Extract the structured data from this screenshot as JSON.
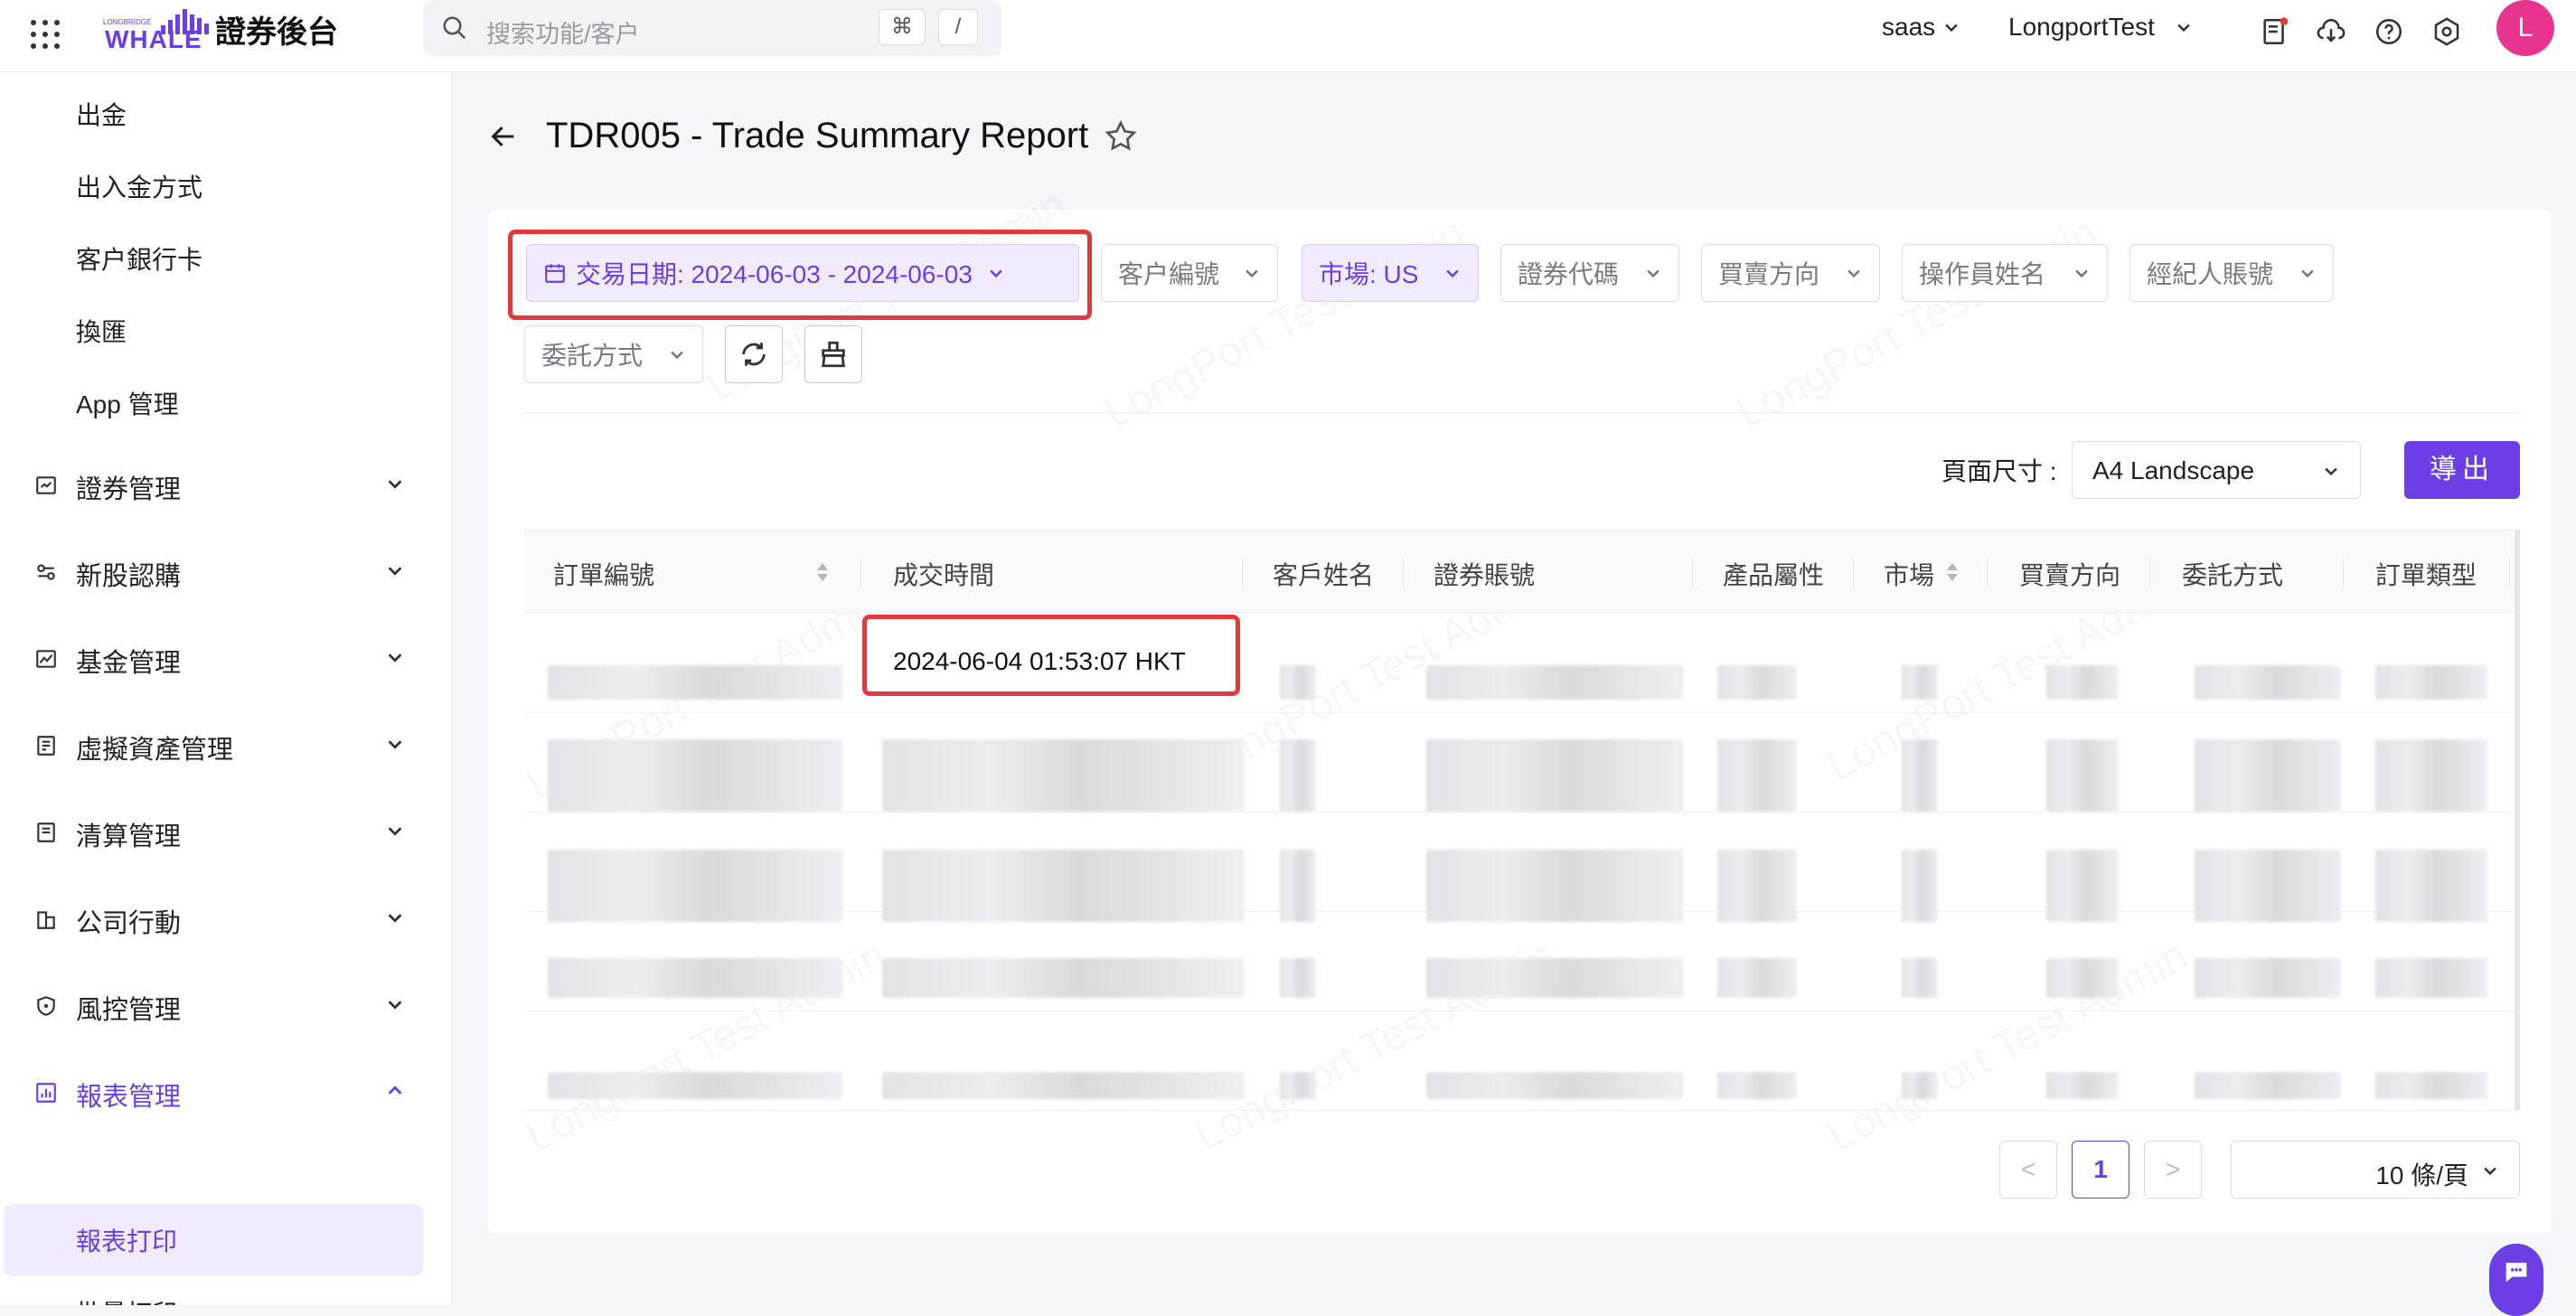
{
  "header": {
    "logo_small": "LONGBRIDGE",
    "logo_brand": "WHALE",
    "app_title": "證券後台",
    "search_placeholder": "搜索功能/客户",
    "search_key1": "⌘",
    "search_key2": "/",
    "tenant": "saas",
    "org": "LongportTest",
    "avatar_letter": "L"
  },
  "sidebar": {
    "sub_items_top": [
      "出金",
      "出入金方式",
      "客户銀行卡",
      "換匯",
      "App 管理"
    ],
    "groups": [
      {
        "label": "證券管理",
        "icon": "securities-icon"
      },
      {
        "label": "新股認購",
        "icon": "ipo-icon"
      },
      {
        "label": "基金管理",
        "icon": "fund-icon"
      },
      {
        "label": "虛擬資產管理",
        "icon": "virtual-asset-icon"
      },
      {
        "label": "清算管理",
        "icon": "clearing-icon"
      },
      {
        "label": "公司行動",
        "icon": "corporate-action-icon"
      },
      {
        "label": "風控管理",
        "icon": "risk-icon"
      },
      {
        "label": "報表管理",
        "icon": "report-icon"
      }
    ],
    "report_children": [
      "報表打印",
      "批量打印"
    ],
    "active_child": "報表打印"
  },
  "page": {
    "title": "TDR005 - Trade Summary Report"
  },
  "filters": {
    "date_range": "交易日期: 2024-06-03 - 2024-06-03",
    "customer_no": "客户編號",
    "market": "市場: US",
    "security_code": "證券代碼",
    "side": "買賣方向",
    "operator": "操作員姓名",
    "broker": "經紀人賬號",
    "order_channel": "委託方式"
  },
  "toolbar": {
    "page_size_label": "頁面尺寸 :",
    "page_size_value": "A4 Landscape",
    "export_label": "導出"
  },
  "table": {
    "columns": [
      "訂單編號",
      "成交時間",
      "客戶姓名",
      "證券賬號",
      "產品屬性",
      "市場",
      "買賣方向",
      "委託方式",
      "訂單類型"
    ],
    "first_row_trade_time": "2024-06-04 01:53:07 HKT"
  },
  "pagination": {
    "prev": "<",
    "current_page": "1",
    "next": ">",
    "per_page": "10 條/頁"
  },
  "watermark": "LongPort Test Admin",
  "colors": {
    "accent": "#6b3ee6",
    "highlight_box": "#e4393c",
    "avatar": "#e8338f"
  }
}
